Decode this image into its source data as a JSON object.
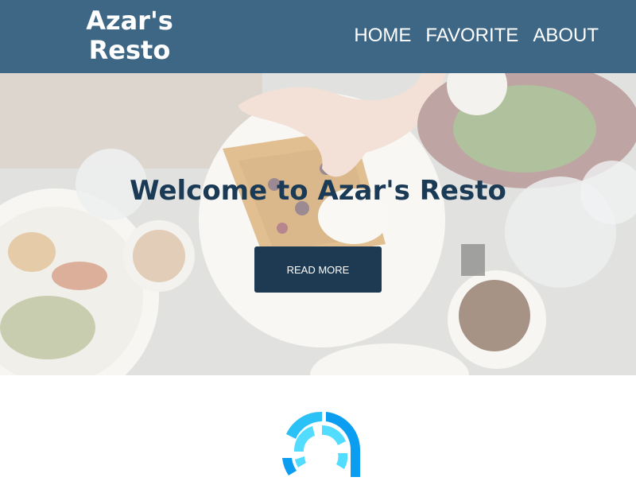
{
  "header": {
    "logo_line1": "Azar's",
    "logo_line2": "Resto",
    "nav": [
      {
        "label": "HOME"
      },
      {
        "label": "FAVORITE"
      },
      {
        "label": "ABOUT"
      }
    ]
  },
  "hero": {
    "title": "Welcome to Azar's Resto",
    "button_label": "READ MORE"
  },
  "colors": {
    "navbar_bg": "#3e6785",
    "title_text": "#1b3a55",
    "button_bg": "#1e3a52",
    "spinner_outer": "#0b9df0",
    "spinner_inner": "#52dcff"
  },
  "icons": {
    "loading": "loading-spinner-icon"
  }
}
